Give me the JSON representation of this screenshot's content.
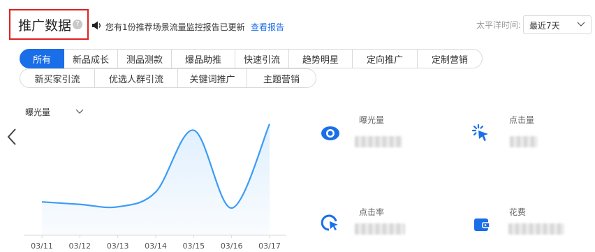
{
  "header": {
    "title": "推广数据",
    "help_icon": "question-circle-icon",
    "notice": "您有1份推荐场景流量监控报告已更新",
    "report_link": "查看报告",
    "timezone_label": "太平洋时间:",
    "range_value": "最近7天"
  },
  "tabs_row1": [
    {
      "label": "所有",
      "active": true
    },
    {
      "label": "新品成长",
      "active": false
    },
    {
      "label": "测品测款",
      "active": false
    },
    {
      "label": "爆品助推",
      "active": false
    },
    {
      "label": "快速引流",
      "active": false
    },
    {
      "label": "趋势明星",
      "active": false
    },
    {
      "label": "定向推广",
      "active": false
    },
    {
      "label": "定制营销",
      "active": false
    }
  ],
  "tabs_row2": [
    {
      "label": "新买家引流",
      "active": false
    },
    {
      "label": "优选人群引流",
      "active": false
    },
    {
      "label": "关键词推广",
      "active": false
    },
    {
      "label": "主题营销",
      "active": false
    }
  ],
  "chart": {
    "metric_select": "曝光量"
  },
  "chart_data": {
    "type": "line",
    "categories": [
      "03/11",
      "03/12",
      "03/13",
      "03/14",
      "03/15",
      "03/16",
      "03/17"
    ],
    "series": [
      {
        "values": [
          27,
          25,
          23,
          35,
          85,
          22,
          90
        ]
      }
    ],
    "ylim": [
      0,
      100
    ],
    "grid": false,
    "area_fill": true,
    "color": "#3b9cf5"
  },
  "kpis": [
    {
      "label": "曝光量",
      "icon": "eye-icon"
    },
    {
      "label": "点击量",
      "icon": "cursor-click-icon"
    },
    {
      "label": "点击率",
      "icon": "click-rate-icon"
    },
    {
      "label": "花费",
      "icon": "wallet-icon"
    }
  ],
  "colors": {
    "accent": "#1a6ee8",
    "highlight_border": "#e02020",
    "line": "#3b9cf5"
  }
}
